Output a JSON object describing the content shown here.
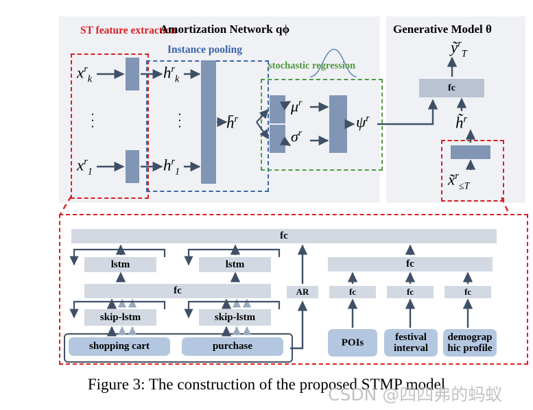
{
  "figure": {
    "caption": "Figure 3: The construction of the proposed STMP model",
    "watermark": "CSDN @四四弗的蚂蚁"
  },
  "panels": {
    "amortization": {
      "title": "Amortization Network qϕ"
    },
    "generative": {
      "title": "Generative Model θ"
    }
  },
  "groups": {
    "st_feature": {
      "label": "ST feature extraction",
      "color": "#d91f1f"
    },
    "instance_pooling": {
      "label": "Instance pooling",
      "color": "#3a63a8"
    },
    "stochastic_regression": {
      "label": "stochastic regression",
      "color": "#4e9a3f"
    }
  },
  "symbols": {
    "x_k": "x",
    "x_k_sup": "r",
    "x_k_sub": "k",
    "x_1": "x",
    "x_1_sup": "r",
    "x_1_sub": "1",
    "h_k": "h",
    "h_k_sup": "r",
    "h_k_sub": "k",
    "h_1": "h",
    "h_1_sup": "r",
    "h_1_sub": "1",
    "h_bar": "h̄",
    "h_bar_sup": "r",
    "mu": "μ",
    "mu_sup": "r",
    "sigma": "σ",
    "sigma_sup": "r",
    "psi": "ψ",
    "psi_sup": "r",
    "y_tilde": "ỹ",
    "y_tilde_sup": "r",
    "y_tilde_sub": "T",
    "h_tilde": "h̃",
    "h_tilde_sup": "r",
    "x_tilde": "x̃",
    "x_tilde_sup": "r",
    "x_tilde_sub": "≤T",
    "dots": "•"
  },
  "blocks": {
    "fc_generative": "fc",
    "fc_top": "fc",
    "lstm_1": "lstm",
    "lstm_2": "lstm",
    "fc_mid": "fc",
    "fc_right": "fc",
    "ar": "AR",
    "fc_poi": "fc",
    "fc_festival": "fc",
    "fc_demographic": "fc",
    "skip_lstm_1": "skip-lstm",
    "skip_lstm_2": "skip-lstm"
  },
  "inputs": {
    "shopping_cart": "shopping cart",
    "purchase": "purchase",
    "pois": "POIs",
    "festival_interval": "festival interval",
    "demographic_profile": "demograp hic profile"
  },
  "colors": {
    "panel_bg": "#eff1f5",
    "solid_rect": "#8096b4",
    "light_bar": "#b9c3d2",
    "bottom_bar": "#d3d9e3",
    "input_box": "#b4c7e0",
    "arrow": "#3f5066",
    "red_dash": "#d91f1f",
    "blue_dash": "#3a63a8",
    "green_dash": "#4e9a3f"
  }
}
